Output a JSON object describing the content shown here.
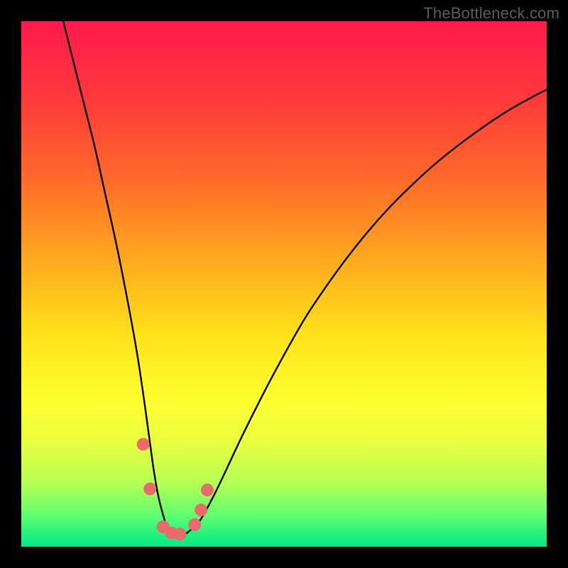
{
  "watermark": "TheBottleneck.com",
  "gradient": {
    "stops": [
      {
        "offset": 0.0,
        "color": "#ff1a4d"
      },
      {
        "offset": 0.15,
        "color": "#ff3a3a"
      },
      {
        "offset": 0.3,
        "color": "#ff6a2a"
      },
      {
        "offset": 0.45,
        "color": "#ffa81f"
      },
      {
        "offset": 0.6,
        "color": "#ffe31a"
      },
      {
        "offset": 0.72,
        "color": "#ffff30"
      },
      {
        "offset": 0.8,
        "color": "#eaff40"
      },
      {
        "offset": 0.88,
        "color": "#b4ff55"
      },
      {
        "offset": 0.94,
        "color": "#60ff70"
      },
      {
        "offset": 1.0,
        "color": "#00e886"
      }
    ]
  },
  "chart_data": {
    "type": "line",
    "title": "",
    "xlabel": "",
    "ylabel": "",
    "xlim": [
      0,
      100
    ],
    "ylim": [
      0,
      100
    ],
    "series": [
      {
        "name": "curve",
        "x": [
          8,
          10,
          12,
          14,
          16,
          18,
          20,
          22,
          23.5,
          25,
          26,
          27,
          28,
          29,
          30,
          31,
          32,
          34,
          36,
          38,
          42,
          46,
          50,
          54,
          58,
          62,
          66,
          70,
          74,
          78,
          82,
          86,
          90,
          94,
          98,
          100
        ],
        "y": [
          100,
          92,
          84,
          76,
          67,
          58,
          48,
          37,
          27,
          16,
          10,
          6,
          3,
          2,
          2,
          2.3,
          3,
          5,
          8.5,
          12.5,
          21,
          29,
          36.5,
          43.5,
          49.5,
          55,
          60,
          64.5,
          68.5,
          72.2,
          75.5,
          78.5,
          81.3,
          83.8,
          86,
          87
        ]
      }
    ],
    "markers": [
      {
        "x": 23.2,
        "y": 19.5
      },
      {
        "x": 24.5,
        "y": 11.0
      },
      {
        "x": 27.0,
        "y": 3.8
      },
      {
        "x": 28.6,
        "y": 2.6
      },
      {
        "x": 30.2,
        "y": 2.4
      },
      {
        "x": 33.0,
        "y": 4.2
      },
      {
        "x": 34.2,
        "y": 7.0
      },
      {
        "x": 35.4,
        "y": 10.8
      }
    ],
    "marker_color": "#e96a6a",
    "marker_radius": 9
  }
}
